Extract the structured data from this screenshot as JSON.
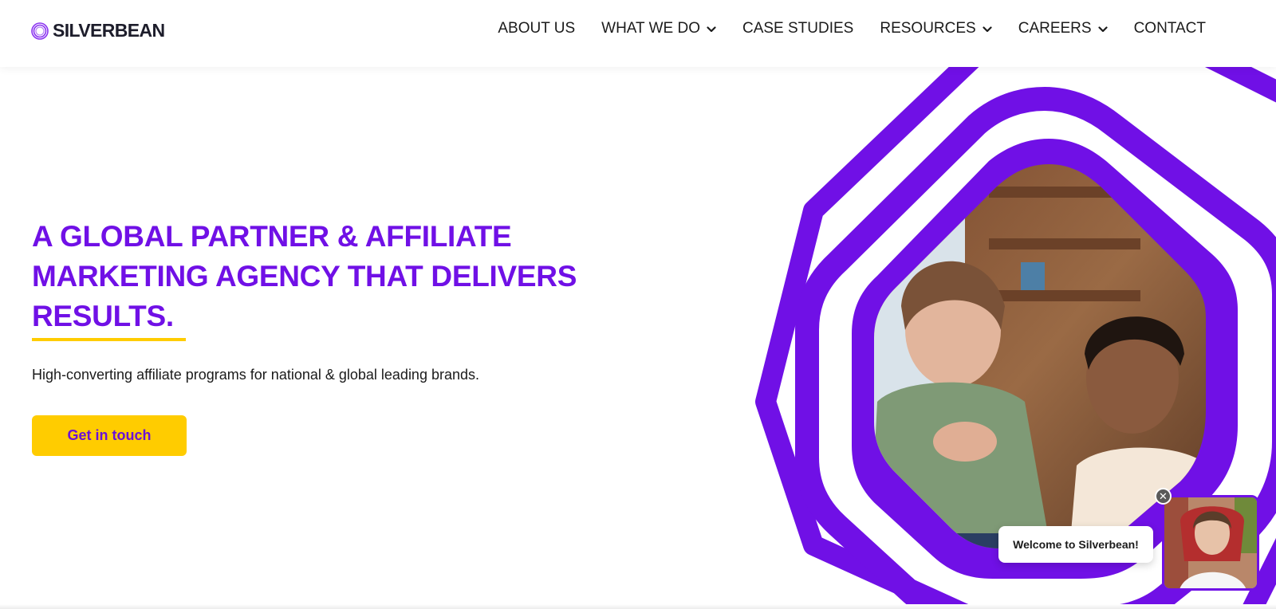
{
  "brand": {
    "name": "SILVERBEAN",
    "accent": "#7010e6",
    "highlight": "#ffcc00"
  },
  "nav": {
    "items": [
      {
        "label": "ABOUT US",
        "has_dropdown": false,
        "icon": "chevron-down-icon"
      },
      {
        "label": "WHAT WE DO",
        "has_dropdown": true,
        "icon": "chevron-down-icon"
      },
      {
        "label": "CASE STUDIES",
        "has_dropdown": false,
        "icon": "chevron-down-icon"
      },
      {
        "label": "RESOURCES",
        "has_dropdown": true,
        "icon": "chevron-down-icon"
      },
      {
        "label": "CAREERS",
        "has_dropdown": true,
        "icon": "chevron-down-icon"
      },
      {
        "label": "CONTACT",
        "has_dropdown": false,
        "icon": "chevron-down-icon"
      }
    ]
  },
  "hero": {
    "title_lines": [
      "A GLOBAL PARTNER & AFFILIATE",
      "MARKETING AGENCY THAT DELIVERS",
      "RESULTS."
    ],
    "subtitle": "High-converting affiliate programs for national & global leading brands.",
    "cta_label": "Get in touch"
  },
  "chat_widget": {
    "greeting": "Welcome to Silverbean!",
    "close_icon": "close-icon"
  }
}
